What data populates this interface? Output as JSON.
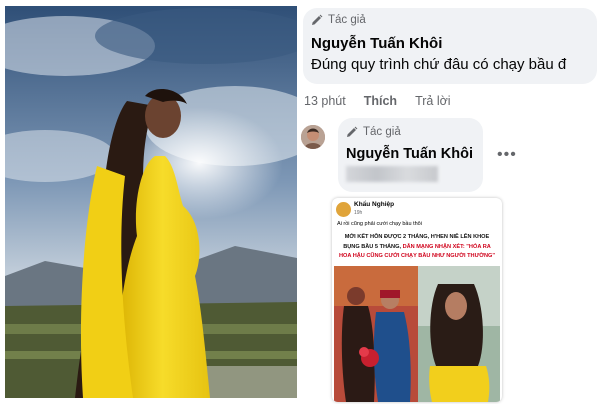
{
  "comment_top": {
    "author_tag": "Tác giả",
    "author_name": "Nguyễn Tuấn Khôi",
    "text": "Đúng quy trình chứ đâu có chạy bầu đ"
  },
  "comment_actions": {
    "time": "13 phút",
    "like": "Thích",
    "reply": "Trả lời"
  },
  "comment_reply": {
    "author_tag": "Tác giả",
    "author_name": "Nguyễn Tuấn Khôi"
  },
  "shared_post": {
    "page_name": "Khẩu Nghiệp",
    "time": "19h",
    "caption": "Ai rồi cũng phải cưới chạy bầu thôi",
    "headline_line1": "MỚI KẾT HÔN ĐƯỢC 2 THÁNG, H'HEN NIÊ LÊN KHOE",
    "headline_line2": "BỤNG BẦU 5 THÁNG,",
    "headline_line2_red": "DÂN MẠNG NHẬN XÉT: \"HÓA RA",
    "headline_line3": "HOA HẬU CŨNG CƯỚI CHẠY BẦU NHƯ NGƯỜI THƯỜNG\""
  },
  "icons": [
    "pencil-icon",
    "more-options-icon"
  ],
  "colors": {
    "bubble": "#f0f2f5",
    "meta_text": "#65676b",
    "headline_red": "#d0021b",
    "dress_yellow": "#f4d21a"
  }
}
